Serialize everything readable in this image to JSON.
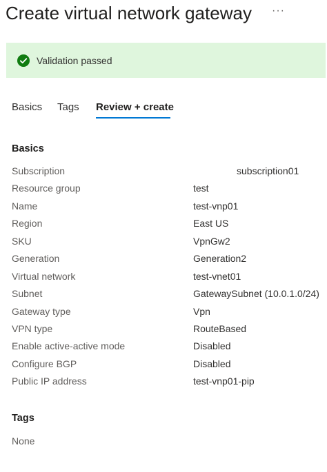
{
  "header": {
    "title": "Create virtual network gateway",
    "more_label": "···"
  },
  "validation": {
    "message": "Validation passed",
    "status_color": "#107c10",
    "background_color": "#dff6dd",
    "icon": "checkmark-circle-icon"
  },
  "tabs": [
    {
      "label": "Basics",
      "active": false
    },
    {
      "label": "Tags",
      "active": false
    },
    {
      "label": "Review + create",
      "active": true
    }
  ],
  "accent_color": "#0078d4",
  "basics": {
    "heading": "Basics",
    "rows": [
      {
        "label": "Subscription",
        "value": "subscription01"
      },
      {
        "label": "Resource group",
        "value": "test"
      },
      {
        "label": "Name",
        "value": "test-vnp01"
      },
      {
        "label": "Region",
        "value": "East US"
      },
      {
        "label": "SKU",
        "value": "VpnGw2"
      },
      {
        "label": "Generation",
        "value": "Generation2"
      },
      {
        "label": "Virtual network",
        "value": "test-vnet01"
      },
      {
        "label": "Subnet",
        "value": "GatewaySubnet (10.0.1.0/24)"
      },
      {
        "label": "Gateway type",
        "value": "Vpn"
      },
      {
        "label": "VPN type",
        "value": "RouteBased"
      },
      {
        "label": "Enable active-active mode",
        "value": "Disabled"
      },
      {
        "label": "Configure BGP",
        "value": "Disabled"
      },
      {
        "label": "Public IP address",
        "value": "test-vnp01-pip"
      }
    ]
  },
  "tags": {
    "heading": "Tags",
    "value": "None"
  }
}
